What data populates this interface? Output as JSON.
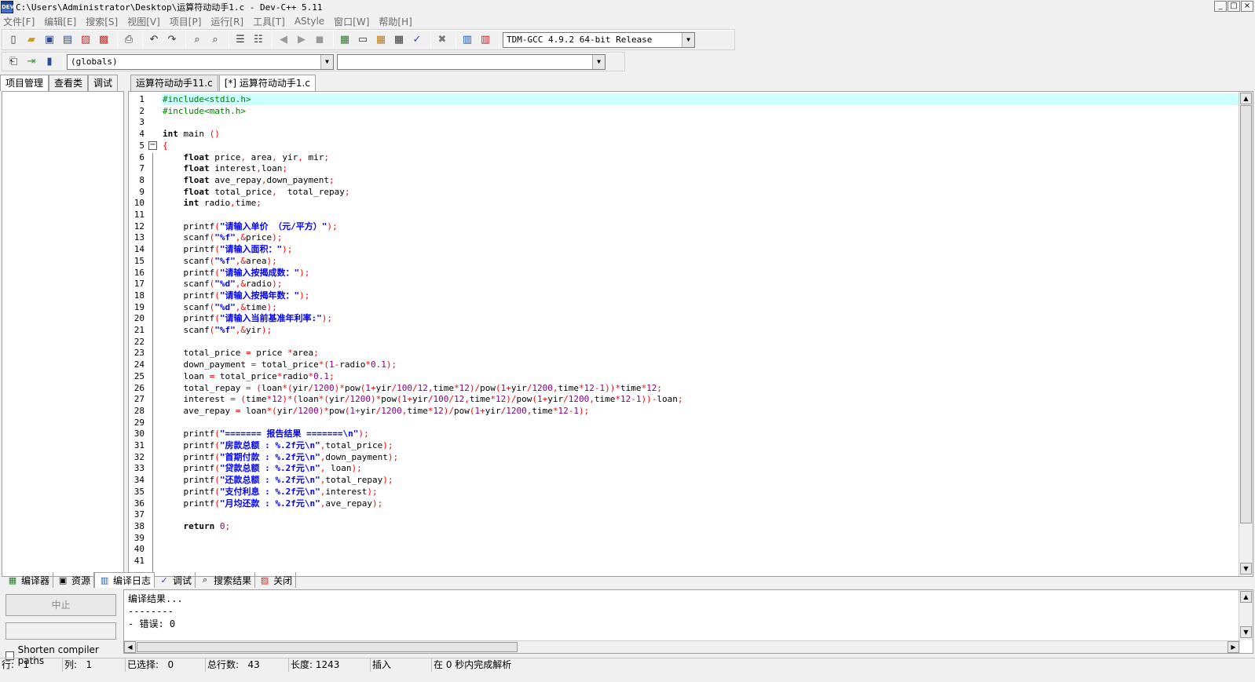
{
  "window": {
    "title": "C:\\Users\\Administrator\\Desktop\\运算符动动手1.c - Dev-C++ 5.11",
    "controls": [
      "_",
      "□",
      "×"
    ]
  },
  "menu": [
    "文件[F]",
    "编辑[E]",
    "搜索[S]",
    "视图[V]",
    "项目[P]",
    "运行[R]",
    "工具[T]",
    "AStyle",
    "窗口[W]",
    "帮助[H]"
  ],
  "toolbar": {
    "compiler_select": "TDM-GCC 4.9.2 64-bit Release",
    "scope_select": "(globals)",
    "function_select": ""
  },
  "left_tabs": [
    "项目管理",
    "查看类",
    "调试"
  ],
  "editor_tabs": [
    "运算符动动手11.c",
    "[*] 运算符动动手1.c"
  ],
  "code_lines": [
    "#include<stdio.h>",
    "#include<math.h>",
    "",
    "int main ()",
    "{",
    "    float price, area, yir, mir;",
    "    float interest,loan;",
    "    float ave_repay,down_payment;",
    "    float total_price,  total_repay;",
    "    int radio,time;",
    "",
    "    printf(\"请输入单价 （元/平方）\");",
    "    scanf(\"%f\",&price);",
    "    printf(\"请输入面积：\");",
    "    scanf(\"%f\",&area);",
    "    printf(\"请输入按揭成数：\");",
    "    scanf(\"%d\",&radio);",
    "    printf(\"请输入按揭年数：\");",
    "    scanf(\"%d\",&time);",
    "    printf(\"请输入当前基准年利率:\");",
    "    scanf(\"%f\",&yir);",
    "",
    "    total_price = price *area;",
    "    down_payment = total_price*(1-radio*0.1);",
    "    loan = total_price*radio*0.1;",
    "    total_repay = (loan*(yir/1200)*pow(1+yir/100/12,time*12)/pow(1+yir/1200,time*12-1))*time*12;",
    "    interest = (time*12)*(loan*(yir/1200)*pow(1+yir/100/12,time*12)/pow(1+yir/1200,time*12-1))-loan;",
    "    ave_repay = loan*(yir/1200)*pow(1+yir/1200,time*12)/pow(1+yir/1200,time*12-1);",
    "",
    "    printf(\"======= 报告结果 =======\\n\");",
    "    printf(\"房款总额 : %.2f元\\n\",total_price);",
    "    printf(\"首期付款 : %.2f元\\n\",down_payment);",
    "    printf(\"贷款总额 : %.2f元\\n\", loan);",
    "    printf(\"还款总额 : %.2f元\\n\",total_repay);",
    "    printf(\"支付利息 : %.2f元\\n\",interest);",
    "    printf(\"月均还款 : %.2f元\\n\",ave_repay);",
    "",
    "    return 0;",
    "",
    "",
    ""
  ],
  "bottom_tabs": [
    "编译器",
    "资源",
    "编译日志",
    "调试",
    "搜索结果",
    "关闭"
  ],
  "bottom_panel": {
    "stop_label": "中止",
    "shorten_label": "Shorten compiler paths",
    "output": [
      "编译结果...",
      "--------",
      "- 错误: 0"
    ]
  },
  "status": {
    "row_label": "行:",
    "row": "1",
    "col_label": "列:",
    "col": "1",
    "sel_label": "已选择:",
    "sel": "0",
    "lines_label": "总行数:",
    "lines": "43",
    "len_label": "长度:",
    "len": "1243",
    "mode": "插入",
    "parse": "在 0 秒内完成解析"
  },
  "colors": {
    "current_line": "#ccffff",
    "preprocessor": "#008000",
    "string": "#0000ff",
    "symbol": "#ff0000",
    "number": "#800080"
  }
}
